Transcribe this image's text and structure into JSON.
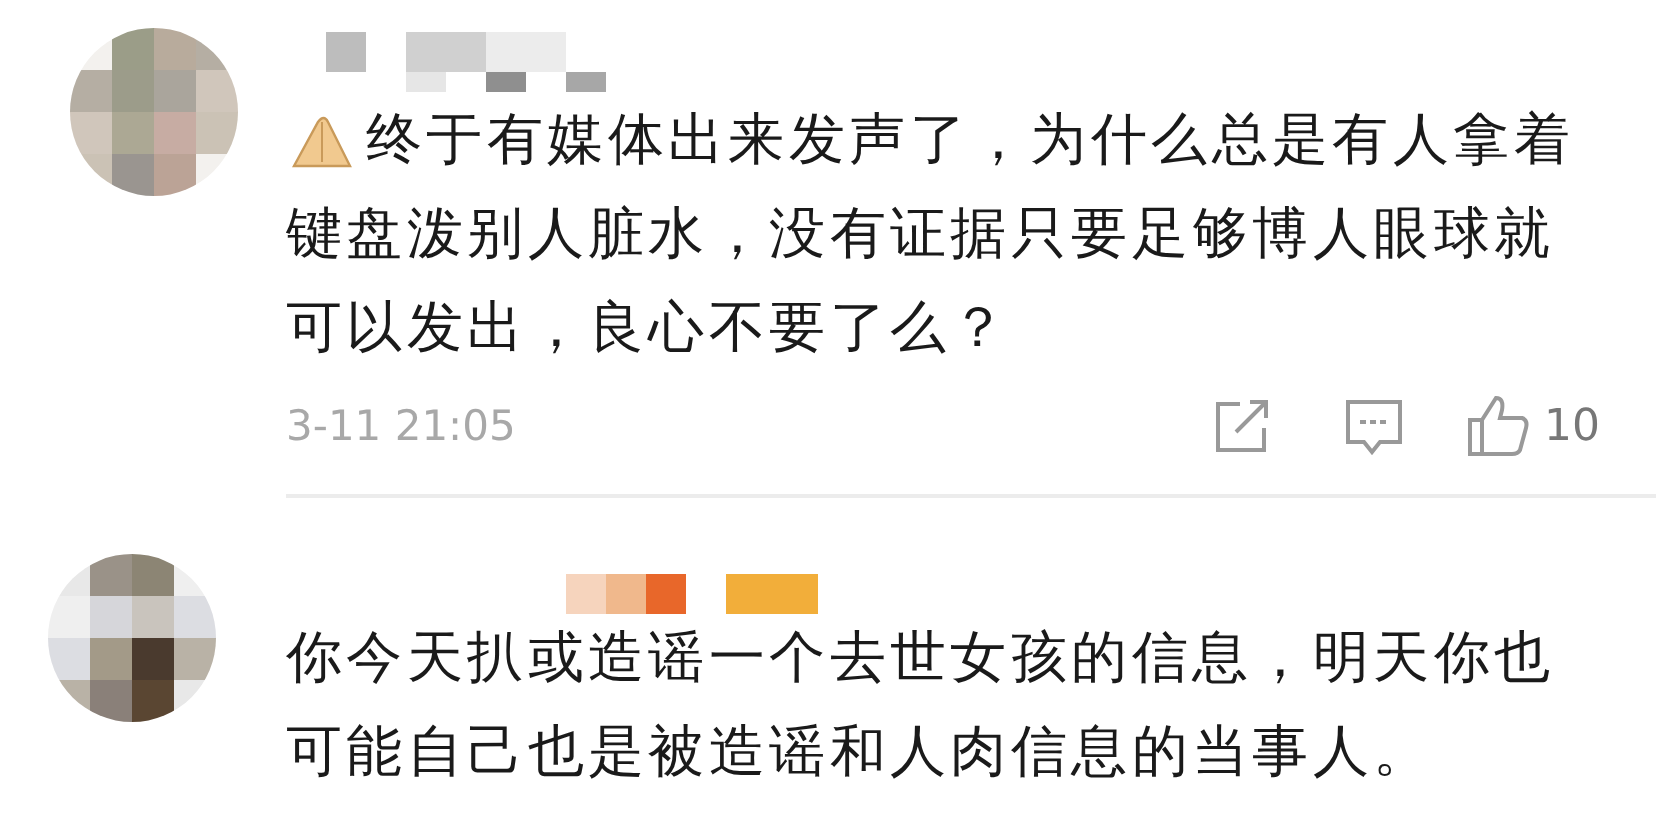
{
  "comments": [
    {
      "emoji": true,
      "text_lines": [
        "终于有媒体出来发声了，为什么总是有人拿着",
        "键盘泼别人脏水，没有证据只要足够博人眼球就",
        "可以发出，良心不要了么？"
      ],
      "time": "3-11 21:05",
      "likes": "10",
      "badge": false
    },
    {
      "emoji": false,
      "text_lines": [
        "你今天扒或造谣一个去世女孩的信息，明天你也",
        "可能自己也是被造谣和人肉信息的当事人。"
      ],
      "badge": true
    }
  ]
}
